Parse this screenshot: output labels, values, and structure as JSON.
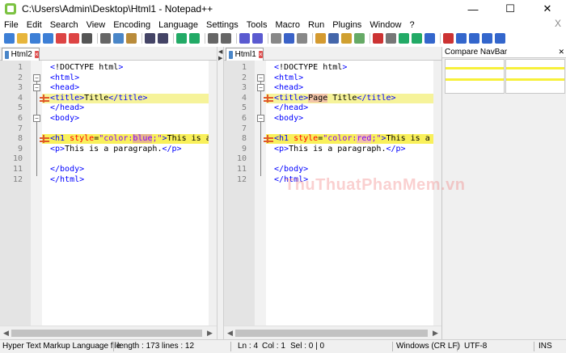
{
  "window": {
    "title": "C:\\Users\\Admin\\Desktop\\Html1 - Notepad++",
    "minimize_glyph": "—",
    "maximize_glyph": "☐",
    "close_glyph": "✕"
  },
  "menu": {
    "items": [
      "File",
      "Edit",
      "Search",
      "View",
      "Encoding",
      "Language",
      "Settings",
      "Tools",
      "Macro",
      "Run",
      "Plugins",
      "Window",
      "?"
    ],
    "close_glyph": "X"
  },
  "toolbar": {
    "icons": [
      "new-file-icon",
      "open-file-icon",
      "save-icon",
      "save-all-icon",
      "close-icon",
      "close-all-icon",
      "print-icon",
      "cut-icon",
      "copy-icon",
      "paste-icon",
      "undo-icon",
      "redo-icon",
      "find-icon",
      "replace-icon",
      "zoom-in-icon",
      "zoom-out-icon",
      "sync-vertical-icon",
      "sync-horizontal-icon",
      "word-wrap-icon",
      "show-all-chars-icon",
      "indent-guide-icon",
      "doc-map-icon",
      "function-list-icon",
      "folder-as-workspace-icon",
      "monitoring-icon",
      "record-macro-icon",
      "stop-record-icon",
      "play-macro-icon",
      "play-multiple-icon",
      "save-macro-icon",
      "compare-icon",
      "compare-clear-icon",
      "compare-prev-icon",
      "compare-next-icon",
      "compare-first-icon"
    ]
  },
  "left_pane": {
    "tab_label": "Html2",
    "lines": [
      {
        "n": "1",
        "html": "<span class='tag'>&lt;</span><span class='doctype'>!DOCTYPE html</span><span class='tag'>&gt;</span>"
      },
      {
        "n": "2",
        "html": "<span class='tag'>&lt;html&gt;</span>"
      },
      {
        "n": "3",
        "html": "<span class='tag'>&lt;head&gt;</span>"
      },
      {
        "n": "4",
        "html": "<span class='tag'>&lt;title&gt;</span><span class='txt'>Title</span><span class='tag'>&lt;/title&gt;</span>"
      },
      {
        "n": "5",
        "html": "<span class='tag'>&lt;/head&gt;</span>"
      },
      {
        "n": "6",
        "html": "<span class='tag'>&lt;body&gt;</span>"
      },
      {
        "n": "7",
        "html": ""
      },
      {
        "n": "8",
        "html": "<span class='tag'>&lt;h1 </span><span class='attr'>style</span><span class='txt'>=</span><span class='val'>\"color:<span class='word-hl-blue'>blue</span>;\"</span><span class='tag'>&gt;</span><span class='txt'>This is a </span>"
      },
      {
        "n": "9",
        "html": "<span class='tag'>&lt;p&gt;</span><span class='txt'>This is a paragraph.</span><span class='tag'>&lt;/p&gt;</span>"
      },
      {
        "n": "10",
        "html": ""
      },
      {
        "n": "11",
        "html": "<span class='tag'>&lt;/body&gt;</span>"
      },
      {
        "n": "12",
        "html": "<span class='tag'>&lt;/html&gt;</span>"
      }
    ]
  },
  "right_pane": {
    "tab_label": "Html1",
    "lines": [
      {
        "n": "1",
        "html": "<span class='tag'>&lt;</span><span class='doctype'>!DOCTYPE html</span><span class='tag'>&gt;</span>"
      },
      {
        "n": "2",
        "html": "<span class='tag'>&lt;html&gt;</span>"
      },
      {
        "n": "3",
        "html": "<span class='tag'>&lt;head&gt;</span>"
      },
      {
        "n": "4",
        "html": "<span class='tag'>&lt;title&gt;</span><span class='txt'><span class='word-hl-red'>Page</span> Title</span><span class='tag'>&lt;/title&gt;</span>"
      },
      {
        "n": "5",
        "html": "<span class='tag'>&lt;/head&gt;</span>"
      },
      {
        "n": "6",
        "html": "<span class='tag'>&lt;body&gt;</span>"
      },
      {
        "n": "7",
        "html": ""
      },
      {
        "n": "8",
        "html": "<span class='tag'>&lt;h1 </span><span class='attr'>style</span><span class='txt'>=</span><span class='val'>\"color:<span class='word-hl-red'>red</span>;\"</span><span class='tag'>&gt;</span><span class='txt'>This is a H</span>"
      },
      {
        "n": "9",
        "html": "<span class='tag'>&lt;p&gt;</span><span class='txt'>This is a paragraph.</span><span class='tag'>&lt;/p&gt;</span>"
      },
      {
        "n": "10",
        "html": ""
      },
      {
        "n": "11",
        "html": "<span class='tag'>&lt;/body&gt;</span>"
      },
      {
        "n": "12",
        "html": "<span class='tag'>&lt;/html&gt;</span>"
      }
    ]
  },
  "navbar": {
    "title": "Compare NavBar",
    "close_glyph": "✕"
  },
  "status": {
    "file_type": "Hyper Text Markup Language file",
    "length": "length : 173",
    "lines": "lines : 12",
    "ln": "Ln : 4",
    "col": "Col : 1",
    "sel": "Sel : 0 | 0",
    "eol": "Windows (CR LF)",
    "encoding": "UTF-8",
    "mode": "INS"
  },
  "watermark": "ThuThuatPhanMem.vn",
  "colors": {
    "diff_highlight": "#f6f39a",
    "diff_marker": "#e05a2a",
    "tag": "#0000ff",
    "attribute": "#ff0000",
    "value": "#8000ff"
  }
}
